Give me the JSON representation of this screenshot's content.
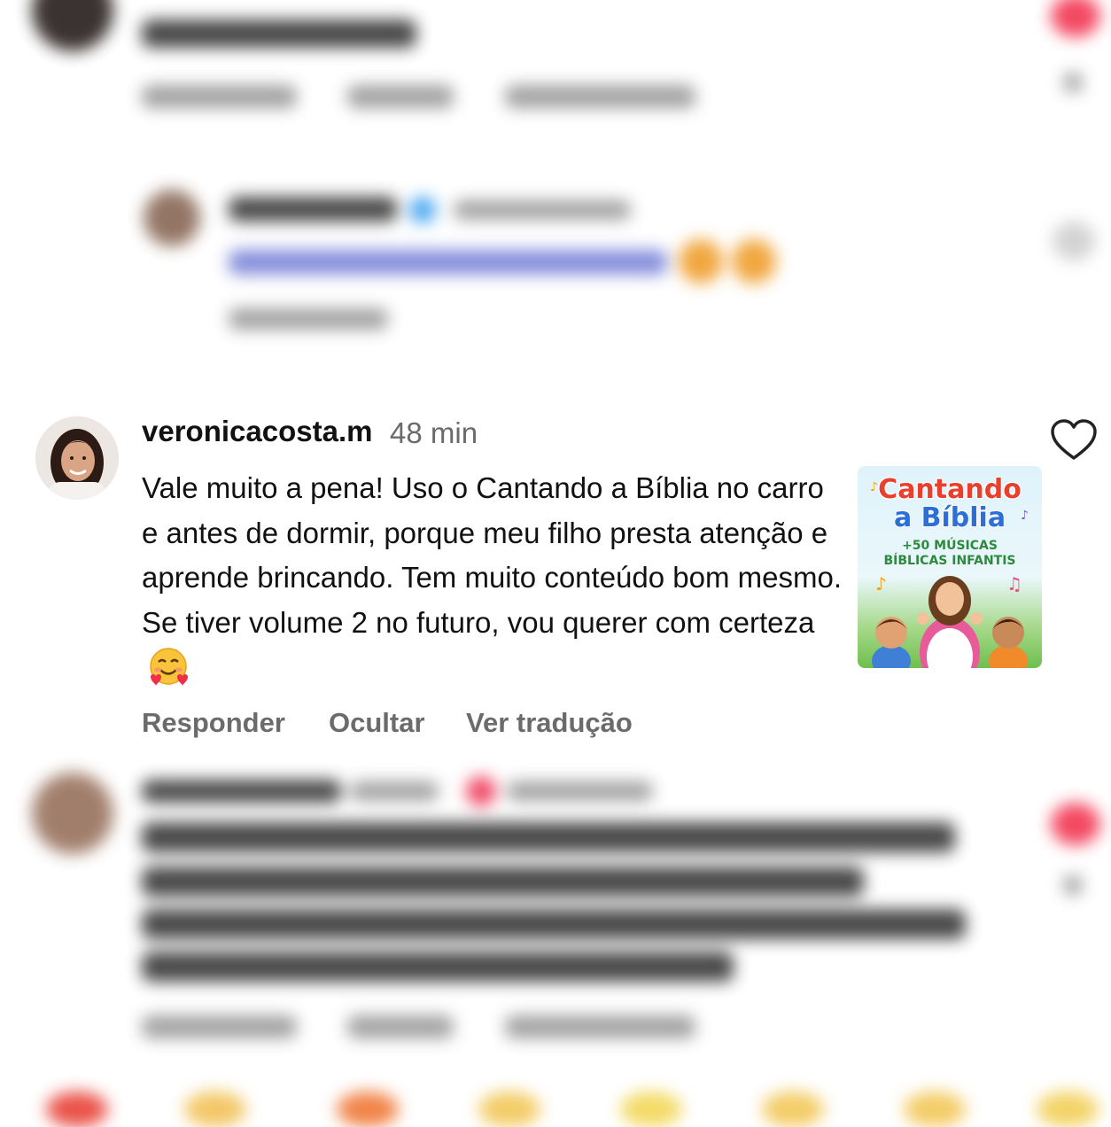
{
  "comment": {
    "username": "veronicacosta.m",
    "time": "48 min",
    "text": "Vale muito a pena! Uso o Cantando a Bíblia no carro e antes de dormir, porque meu filho presta atenção e aprende brincando. Tem muito conteúdo bom mesmo. Se tiver volume 2 no futuro, vou querer com certeza",
    "emoji_icon": "smiling-face-with-hearts-icon",
    "like_icon": "heart-outline-icon",
    "actions": {
      "reply": "Responder",
      "hide": "Ocultar",
      "translate": "Ver tradução"
    },
    "attachment": {
      "title_line1": "Cantando",
      "title_line2": "a Bíblia",
      "subtitle_line1": "+50 MÚSICAS",
      "subtitle_line2": "BÍBLICAS INFANTIS"
    }
  },
  "colors": {
    "primary_text": "#111111",
    "secondary_text": "#6b6b6b",
    "like_red": "#f23a55"
  }
}
